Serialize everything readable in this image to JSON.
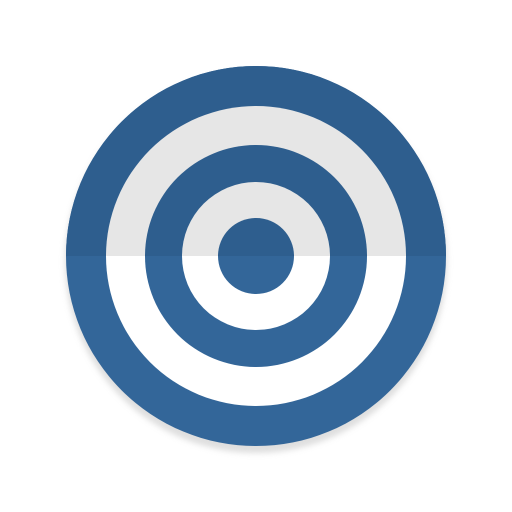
{
  "icon": {
    "name": "target-icon",
    "colors": {
      "ring_blue": "#336699",
      "ring_blue_shade": "#2E5E8E",
      "ring_light_top": "#E6E6E6",
      "ring_light_bottom": "#FFFFFF",
      "shadow": "#C9C9C9"
    }
  }
}
